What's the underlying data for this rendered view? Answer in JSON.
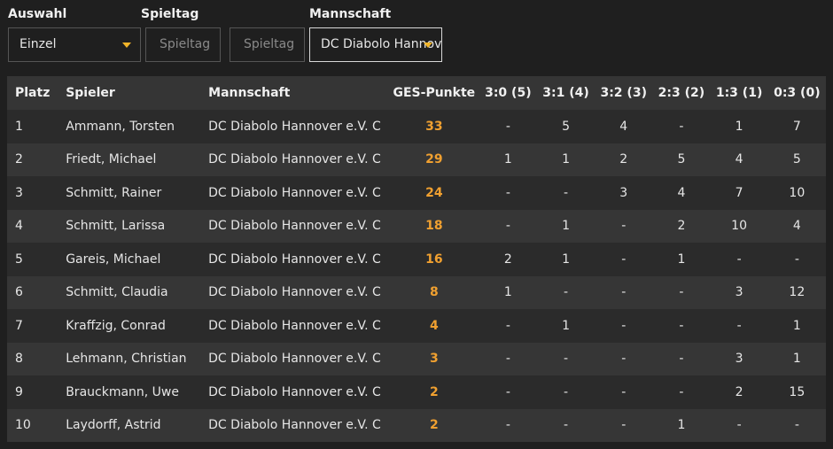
{
  "filters": {
    "auswahl_label": "Auswahl",
    "auswahl_value": "Einzel",
    "spieltag_label": "Spieltag",
    "spieltag_from": "Spieltag",
    "spieltag_to": "Spieltag",
    "mannschaft_label": "Mannschaft",
    "mannschaft_value": "DC Diabolo Hannover e.V. C"
  },
  "colors": {
    "accent": "#f0b429",
    "points": "#f0a030",
    "background": "#1f1f1f"
  },
  "icons": {
    "dropdown": "caret-down-icon"
  },
  "table": {
    "headers": [
      "Platz",
      "Spieler",
      "Mannschaft",
      "GES-Punkte",
      "3:0 (5)",
      "3:1 (4)",
      "3:2 (3)",
      "2:3 (2)",
      "1:3 (1)",
      "0:3 (0)"
    ],
    "rows": [
      [
        "1",
        "Ammann, Torsten",
        "DC Diabolo Hannover e.V. C",
        "33",
        "-",
        "5",
        "4",
        "-",
        "1",
        "7"
      ],
      [
        "2",
        "Friedt, Michael",
        "DC Diabolo Hannover e.V. C",
        "29",
        "1",
        "1",
        "2",
        "5",
        "4",
        "5"
      ],
      [
        "3",
        "Schmitt, Rainer",
        "DC Diabolo Hannover e.V. C",
        "24",
        "-",
        "-",
        "3",
        "4",
        "7",
        "10"
      ],
      [
        "4",
        "Schmitt, Larissa",
        "DC Diabolo Hannover e.V. C",
        "18",
        "-",
        "1",
        "-",
        "2",
        "10",
        "4"
      ],
      [
        "5",
        "Gareis, Michael",
        "DC Diabolo Hannover e.V. C",
        "16",
        "2",
        "1",
        "-",
        "1",
        "-",
        "-"
      ],
      [
        "6",
        "Schmitt, Claudia",
        "DC Diabolo Hannover e.V. C",
        "8",
        "1",
        "-",
        "-",
        "-",
        "3",
        "12"
      ],
      [
        "7",
        "Kraffzig, Conrad",
        "DC Diabolo Hannover e.V. C",
        "4",
        "-",
        "1",
        "-",
        "-",
        "-",
        "1"
      ],
      [
        "8",
        "Lehmann, Christian",
        "DC Diabolo Hannover e.V. C",
        "3",
        "-",
        "-",
        "-",
        "-",
        "3",
        "1"
      ],
      [
        "9",
        "Brauckmann, Uwe",
        "DC Diabolo Hannover e.V. C",
        "2",
        "-",
        "-",
        "-",
        "-",
        "2",
        "15"
      ],
      [
        "10",
        "Laydorff, Astrid",
        "DC Diabolo Hannover e.V. C",
        "2",
        "-",
        "-",
        "-",
        "1",
        "-",
        "-"
      ]
    ]
  }
}
